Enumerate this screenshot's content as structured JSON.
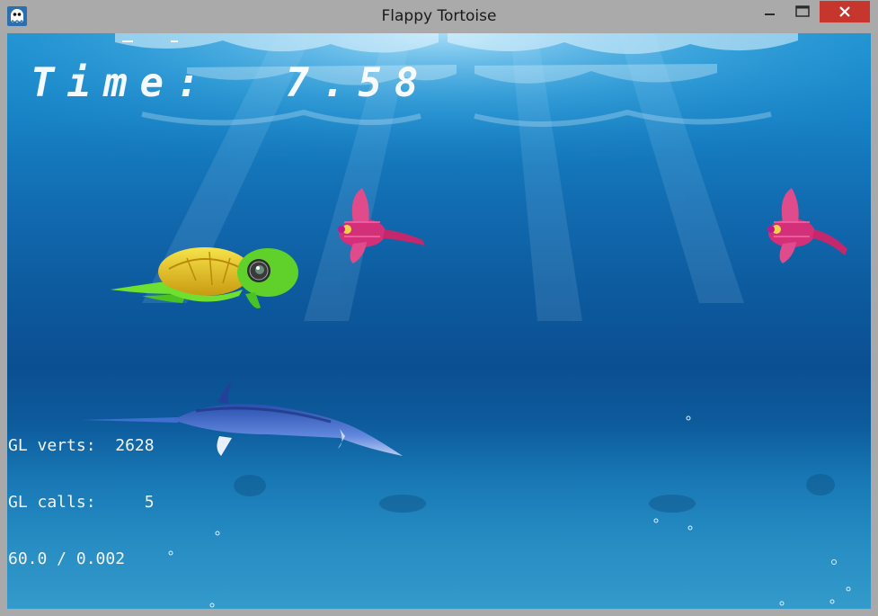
{
  "window": {
    "title": "Flappy Tortoise",
    "app_icon": "ghost-app-icon",
    "controls": [
      "minimize-icon",
      "maximize-icon",
      "close-icon"
    ]
  },
  "hud": {
    "time_label": "Time:",
    "time_value": "7.58"
  },
  "stats": {
    "verts_label": "GL verts:",
    "verts_value": "2628",
    "calls_label": "GL calls:",
    "calls_value": "5",
    "fps": "60.0 / 0.002"
  },
  "colors": {
    "close_button": "#c7362d",
    "water_top": "#1c8fcf",
    "water_deep": "#0b4f92",
    "turtle_shell": "#e6c21a",
    "turtle_skin": "#5fd12a",
    "fish": "#d4307a",
    "swordfish": "#3a64c4"
  }
}
